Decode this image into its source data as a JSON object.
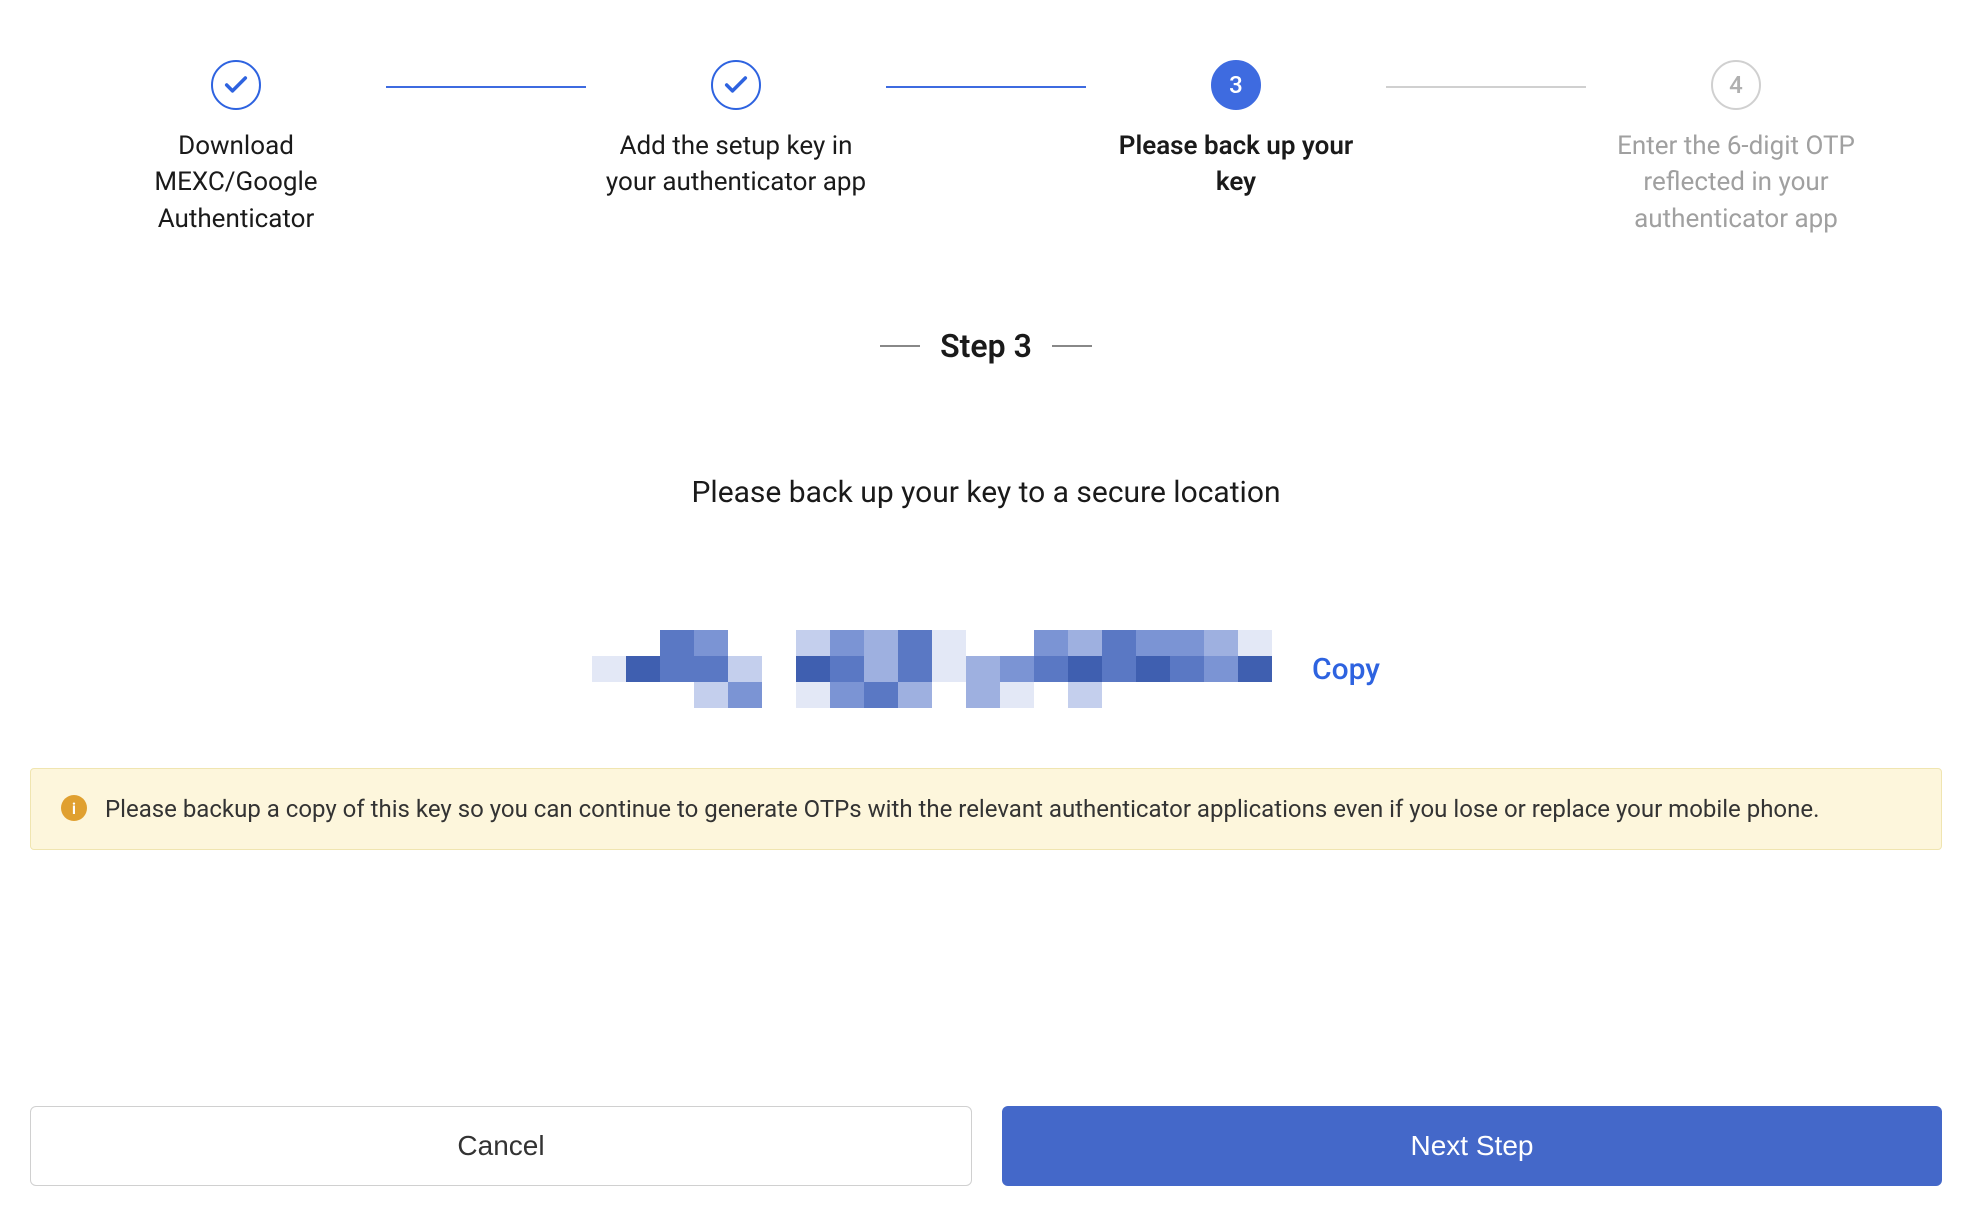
{
  "stepper": {
    "steps": [
      {
        "label": "Download MEXC/Google Authenticator",
        "state": "done"
      },
      {
        "label": "Add the setup key in your authenticator app",
        "state": "done"
      },
      {
        "label": "Please back up your key",
        "state": "active",
        "number": "3"
      },
      {
        "label": "Enter the 6-digit OTP reflected in your authenticator app",
        "state": "pending",
        "number": "4"
      }
    ]
  },
  "heading": "Step 3",
  "instruction": "Please back up your key to a secure location",
  "key": {
    "copy_label": "Copy"
  },
  "warning": {
    "text": "Please backup a copy of this key so you can continue to generate OTPs with the relevant authenticator applications even if you lose or replace your mobile phone."
  },
  "buttons": {
    "cancel": "Cancel",
    "next": "Next Step"
  }
}
